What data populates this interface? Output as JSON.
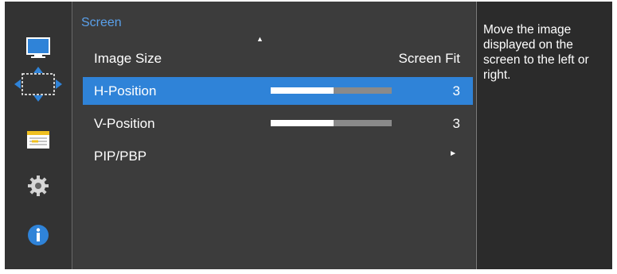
{
  "sidebar": {
    "icons": [
      "monitor-icon",
      "position-arrows-icon",
      "settings-sliders-icon",
      "gear-icon",
      "info-icon"
    ],
    "active": "position-arrows-icon"
  },
  "menu": {
    "title": "Screen",
    "scroll_up_indicator": "▲",
    "items": [
      {
        "label": "Image Size",
        "value": "Screen Fit"
      },
      {
        "label": "H-Position",
        "value": "3",
        "level_fraction": 0.52,
        "selected": true
      },
      {
        "label": "V-Position",
        "value": "3",
        "level_fraction": 0.52
      },
      {
        "label": "PIP/PBP",
        "value": "►"
      }
    ]
  },
  "help": {
    "text": "Move the image displayed on the screen to the left or right."
  },
  "colors": {
    "accent": "#2f83d8",
    "title": "#5aa0ea",
    "panel": "#3c3c3c"
  }
}
